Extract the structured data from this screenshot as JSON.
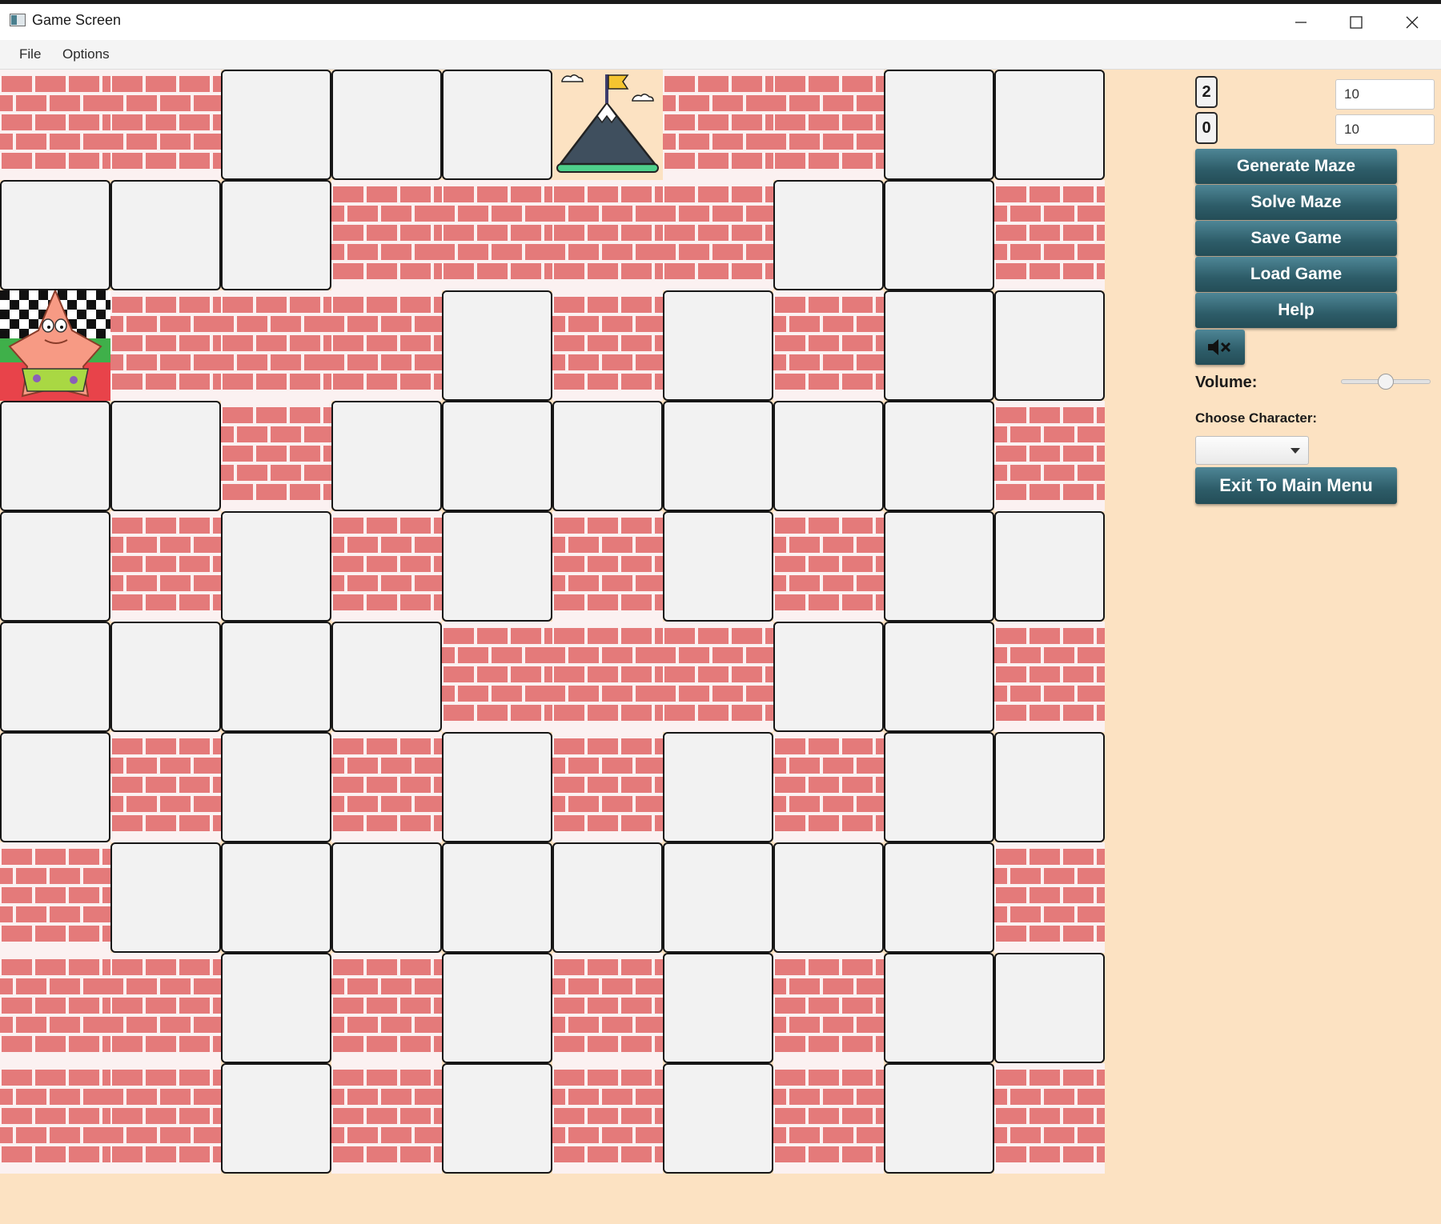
{
  "window": {
    "title": "Game Screen",
    "controls": [
      "minimize-icon",
      "maximize-icon",
      "close-icon"
    ]
  },
  "menu": [
    "File",
    "Options"
  ],
  "maze": {
    "rows": 10,
    "cols": 10,
    "legend": {
      "W": "brick-wall",
      "P": "open-path",
      "G": "goal-mountain-flag",
      "S": "player-patrick"
    },
    "grid": [
      "WWPPPGWWPP",
      "PPPWWWWPPW",
      "SWWWPWPWPP",
      "PPWPPPPPPW",
      "PWPWPWPWPP",
      "PPPPWWWPPW",
      "PWPWPWPWPP",
      "WPPPPPPPPW",
      "WWPWPWPWPP",
      "WWPWPWPWPW"
    ]
  },
  "panel": {
    "counter_top": "2",
    "counter_bottom": "0",
    "rows_value": "10",
    "cols_value": "10",
    "buttons": {
      "generate": "Generate Maze",
      "solve": "Solve Maze",
      "save": "Save Game",
      "load": "Load Game",
      "help": "Help",
      "exit": "Exit To Main Menu"
    },
    "mute_icon": "speaker-muted-icon",
    "volume_label": "Volume:",
    "volume_level": 0.5,
    "character_label": "Choose Character:",
    "character_value": ""
  },
  "colors": {
    "background": "#FCE2C2",
    "brick": "#E47A7A",
    "path": "#F2F2F2",
    "button": "#2d5c68"
  }
}
